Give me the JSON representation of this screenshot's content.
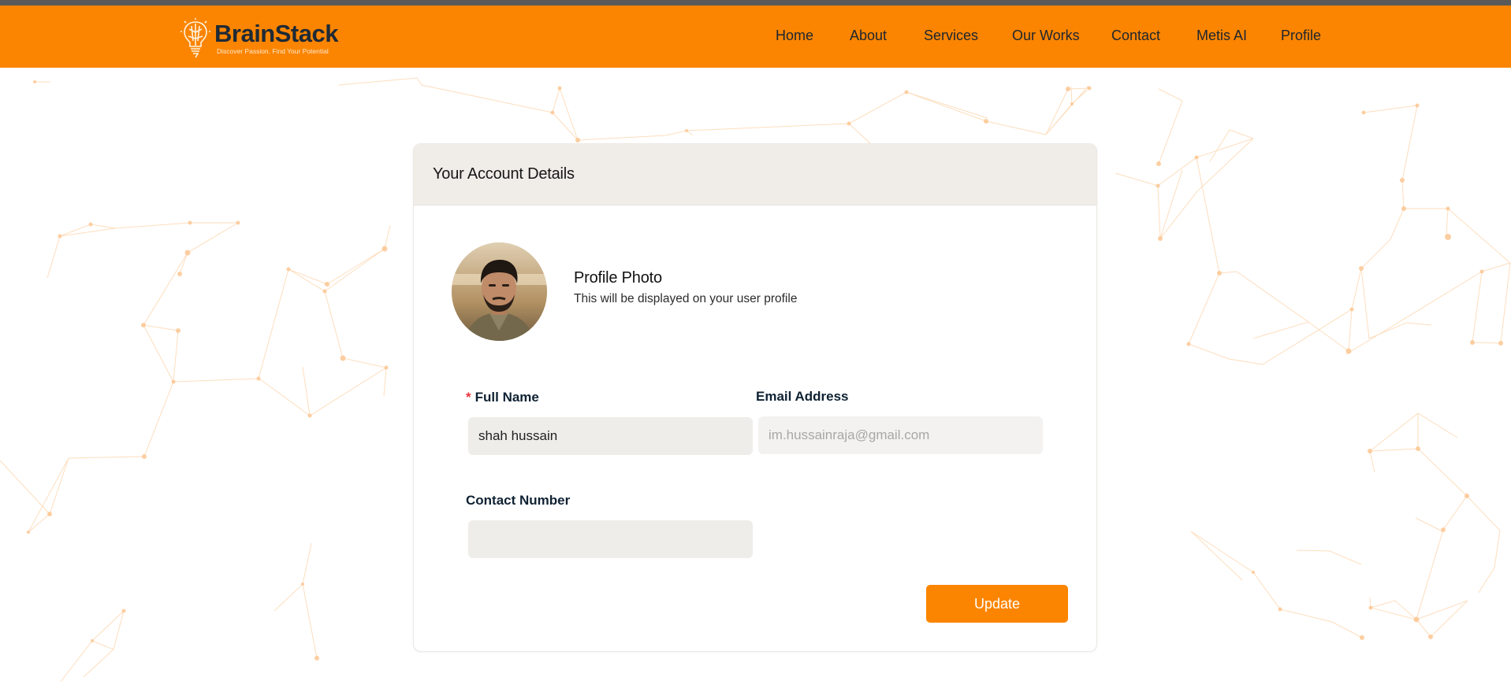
{
  "brand": {
    "name": "BrainStack",
    "tagline": "Discover Passion. Find Your Potential",
    "accent_color": "#fb8500",
    "text_color": "#1e2a36"
  },
  "nav": {
    "items": [
      {
        "label": "Home"
      },
      {
        "label": "About"
      },
      {
        "label": "Services"
      },
      {
        "label": "Our Works"
      },
      {
        "label": "Contact"
      },
      {
        "label": "Metis AI"
      },
      {
        "label": "Profile"
      }
    ]
  },
  "account_card": {
    "title": "Your Account Details",
    "profile_photo": {
      "title": "Profile Photo",
      "subtitle": "This will be displayed on your user profile"
    },
    "fields": {
      "full_name": {
        "label": "Full Name",
        "required_marker": "*",
        "value": "shah hussain"
      },
      "email": {
        "label": "Email Address",
        "placeholder": "im.hussainraja@gmail.com"
      },
      "contact_number": {
        "label": "Contact Number",
        "value": ""
      }
    },
    "update_button": "Update"
  }
}
